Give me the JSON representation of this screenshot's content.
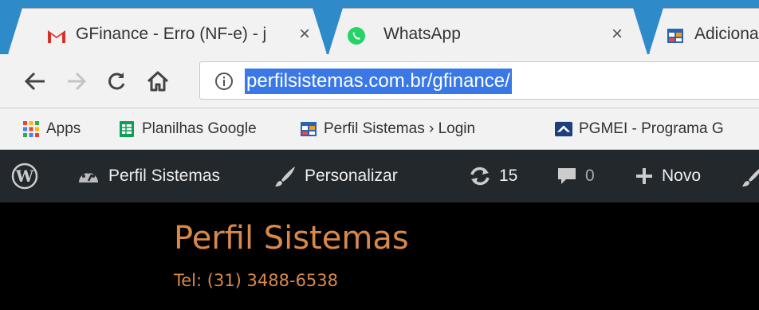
{
  "tabs": [
    {
      "title": "GFinance - Erro (NF-e) - j",
      "icon": "gmail-icon",
      "close": "×"
    },
    {
      "title": "WhatsApp",
      "icon": "whatsapp-icon",
      "close": "×"
    },
    {
      "title": "Adiciona",
      "icon": "calendar-icon"
    }
  ],
  "toolbar": {
    "url": "perfilsistemas.com.br/gfinance/"
  },
  "bookmarks": [
    {
      "label": "Apps",
      "icon": "apps-grid-icon"
    },
    {
      "label": "Planilhas Google",
      "icon": "sheets-icon"
    },
    {
      "label": "Perfil Sistemas › Login",
      "icon": "calendar-icon"
    },
    {
      "label": "PGMEI - Programa G",
      "icon": "pgmei-icon"
    }
  ],
  "adminbar": {
    "site_name": "Perfil Sistemas",
    "customize": "Personalizar",
    "updates_count": "15",
    "comments_count": "0",
    "new_label": "Novo"
  },
  "site": {
    "title": "Perfil Sistemas",
    "tel": "Tel: (31) 3488-6538"
  },
  "colors": {
    "tabstrip": "#2f8ac9",
    "chrome": "#f2f2f2",
    "url_highlight": "#3b78e7",
    "adminbar": "#23282d",
    "site_accent": "#d9894a"
  }
}
